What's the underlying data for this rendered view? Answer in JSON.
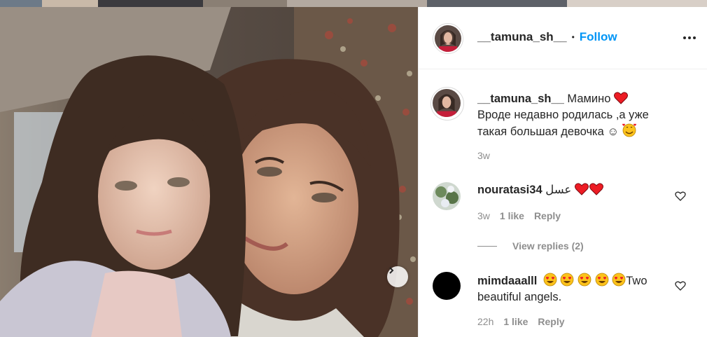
{
  "colors": {
    "link_blue": "#0095f6",
    "text": "#262626",
    "muted": "#8e8e8e",
    "heart_red": "#ed1c24"
  },
  "header": {
    "username": "__tamuna_sh__",
    "separator": "•",
    "follow_label": "Follow"
  },
  "caption": {
    "username": "__tamuna_sh__",
    "line1": "Мамино",
    "line2": "Вроде недавно родилась ,а уже",
    "line3": "такая большая девочка ☺",
    "time": "3w"
  },
  "comments": [
    {
      "username": "nouratasi34",
      "text": "عسل",
      "time": "3w",
      "likes": "1 like",
      "reply_label": "Reply",
      "view_replies": "View replies (2)"
    },
    {
      "username": "mimdaaalll",
      "text_line1": "Two",
      "text_line2": "beautiful angels.",
      "time": "22h",
      "likes": "1 like",
      "reply_label": "Reply"
    }
  ]
}
